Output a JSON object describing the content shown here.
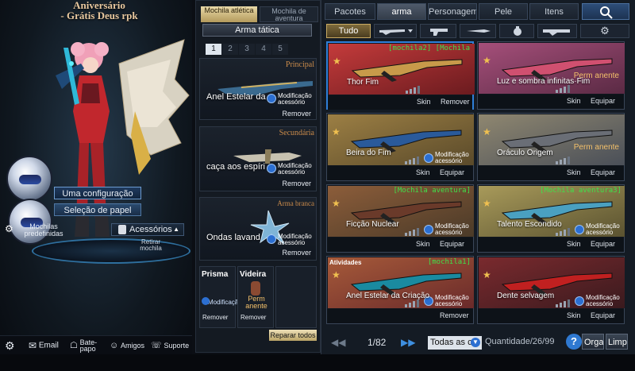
{
  "left": {
    "anniversary_line1": "Aniversário",
    "anniversary_line2": "- Grátis Deus rpk",
    "btn_config": "Uma configuração",
    "btn_papel": "Seleção de papel",
    "mochilas": "Mochilas predefinidas",
    "acessorios": "Acessórios",
    "retirar": "Retirar mochila"
  },
  "bottombar": {
    "email": "Email",
    "bate_papo": "Bate-papo",
    "amigos": "Amigos",
    "suporte": "Suporte"
  },
  "mid": {
    "tab_atletica": "Mochila atlética",
    "tab_aventura": "Mochila de aventura",
    "arma_tatica": "Arma tática",
    "pages": [
      "1",
      "2",
      "3",
      "4",
      "5"
    ],
    "active_page": "1",
    "slots": [
      {
        "label": "Principal",
        "name": "Anel Estelar da",
        "mod": "Modificação acessório",
        "remove": "Remover"
      },
      {
        "label": "Secundária",
        "name": "caça aos espíri",
        "mod": "Modificação acessório",
        "remove": "Remover"
      },
      {
        "label": "Arma branca",
        "name": "Ondas lavand",
        "mod": "Modificação acessório",
        "remove": "Remover"
      }
    ],
    "minis": [
      {
        "title": "Prisma",
        "tag": "Modificação",
        "remove": "Remover"
      },
      {
        "title": "Videira",
        "tag": "Perm anente",
        "remove": "Remover"
      }
    ],
    "reparar": "Reparar todos"
  },
  "right": {
    "tabs": [
      "Pacotes",
      "arma",
      "Personagem",
      "Pele",
      "Itens"
    ],
    "active_tab": "arma",
    "filter_all": "Tudo",
    "cards": [
      {
        "name": "Thor Fim",
        "tag": "[mochila2] [Mochila",
        "perm": "",
        "mod": "",
        "btn_left": "Skin",
        "btn_right": "Remover",
        "selected": true
      },
      {
        "name": "Luz e sombra infinitas·Fim",
        "tag": "",
        "perm": "Perm anente",
        "mod": "",
        "btn_left": "Skin",
        "btn_right": "Equipar",
        "selected": false
      },
      {
        "name": "Beira do Fim",
        "tag": "",
        "perm": "",
        "mod": "Modificação acessório",
        "btn_left": "Skin",
        "btn_right": "Equipar",
        "selected": false
      },
      {
        "name": "Oráculo Origem",
        "tag": "",
        "perm": "Perm anente",
        "mod": "",
        "btn_left": "Skin",
        "btn_right": "Equipar",
        "selected": false
      },
      {
        "name": "Ficção Nuclear",
        "tag": "[Mochila aventura]",
        "perm": "",
        "mod": "Modificação acessório",
        "btn_left": "Skin",
        "btn_right": "Equipar",
        "selected": false
      },
      {
        "name": "Talento Escondido",
        "tag": "[Mochila aventura3]",
        "perm": "",
        "mod": "Modificação acessório",
        "btn_left": "Skin",
        "btn_right": "Equipar",
        "selected": false
      },
      {
        "name": "Anel Estelar da Criação",
        "tag": "[mochila1]",
        "perm": "",
        "mod": "Modificação acessório",
        "btn_left": "",
        "btn_right": "Remover",
        "selected": false,
        "badge": "Atividades"
      },
      {
        "name": "Dente selvagem",
        "tag": "",
        "perm": "",
        "mod": "Modificação acessório",
        "btn_left": "Skin",
        "btn_right": "Equipar",
        "selected": false
      }
    ],
    "pager": "1/82",
    "sort": "Todas as c",
    "quantity": "Quantidade/26/99",
    "help": "?",
    "organize": "Orga",
    "clean": "Limp"
  }
}
